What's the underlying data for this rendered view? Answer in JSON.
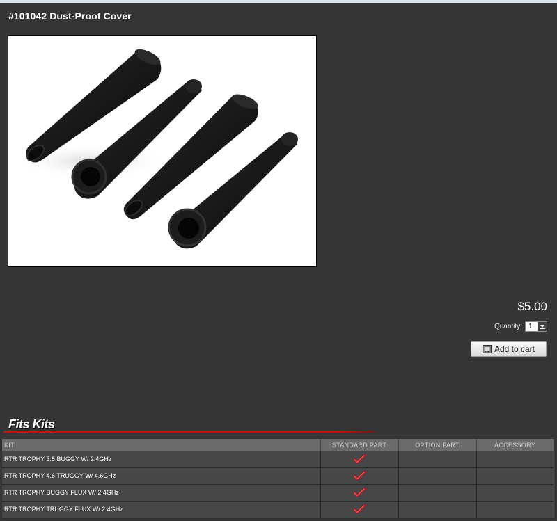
{
  "product": {
    "title": "#101042  Dust-Proof Cover",
    "price": "$5.00",
    "quantity_label": "Quantity:",
    "quantity_value": "1",
    "add_to_cart_label": "Add to cart"
  },
  "fits_kits": {
    "heading": "Fits Kits",
    "columns": [
      "KIT",
      "STANDARD PART",
      "OPTION PART",
      "ACCESSORY"
    ],
    "rows": [
      {
        "kit": "RTR TROPHY 3.5 BUGGY W/ 2.4GHz",
        "standard": true,
        "option": false,
        "accessory": false
      },
      {
        "kit": "RTR TROPHY 4.6 TRUGGY W/ 4.6GHz",
        "standard": true,
        "option": false,
        "accessory": false
      },
      {
        "kit": "RTR TROPHY BUGGY FLUX W/ 2.4GHz",
        "standard": true,
        "option": false,
        "accessory": false
      },
      {
        "kit": "RTR TROPHY TRUGGY FLUX W/ 2.4GHz",
        "standard": true,
        "option": false,
        "accessory": false
      }
    ]
  },
  "icons": {
    "cart": "cart-icon",
    "check": "checkmark-icon",
    "dropdown": "chevron-down-icon"
  },
  "colors": {
    "background": "#353535",
    "accent_red": "#c71010",
    "check_red": "#c0141a"
  }
}
